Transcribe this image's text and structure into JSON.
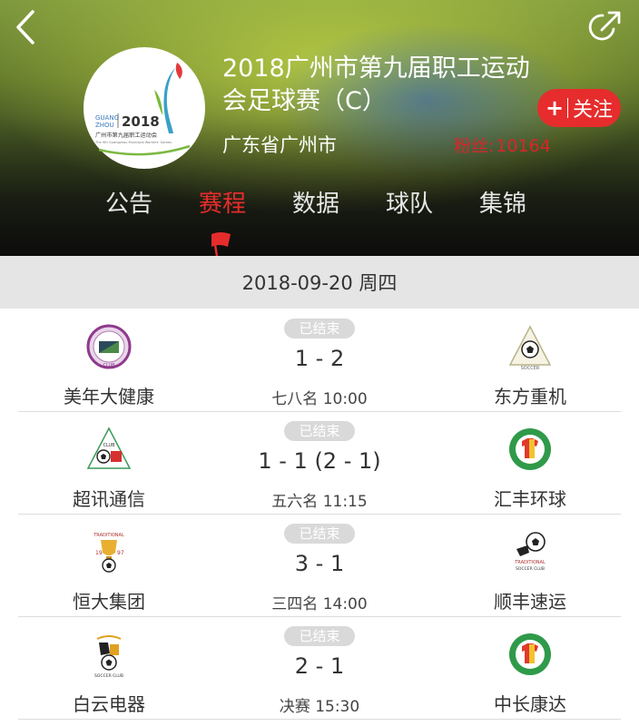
{
  "header": {
    "title": "2018广州市第九届职工运动会足球赛（C）",
    "location": "广东省广州市",
    "follow_plus": "+",
    "follow_label": "关注",
    "fans_label": "粉丝:",
    "fans_count": "10164",
    "logo_text": {
      "city_top": "GUANG",
      "city_bottom": "ZHOU",
      "year": "2018",
      "event_cn": "广州市第九届职工运动会",
      "event_en": "The 9th Guangzhou Municipal Workers' Games"
    }
  },
  "tabs": [
    {
      "label": "公告",
      "active": false
    },
    {
      "label": "赛程",
      "active": true
    },
    {
      "label": "数据",
      "active": false
    },
    {
      "label": "球队",
      "active": false
    },
    {
      "label": "集锦",
      "active": false
    }
  ],
  "date": "2018-09-20 周四",
  "matches": [
    {
      "status": "已结束",
      "score": "1 - 2",
      "round": "七八名 10:00",
      "home": {
        "name": "美年大健康",
        "badge": "purple-circle-badge-icon"
      },
      "away": {
        "name": "东方重机",
        "badge": "triangle-soccer-badge-icon"
      }
    },
    {
      "status": "已结束",
      "score": "1 - 1 (2 - 1)",
      "round": "五六名 11:15",
      "home": {
        "name": "超讯通信",
        "badge": "triangle-soccer-badge-icon"
      },
      "away": {
        "name": "汇丰环球",
        "badge": "green-circle-jersey-badge-icon"
      }
    },
    {
      "status": "已结束",
      "score": "3 - 1",
      "round": "三四名 14:00",
      "home": {
        "name": "恒大集团",
        "badge": "trophy-soccer-badge-icon"
      },
      "away": {
        "name": "顺丰速运",
        "badge": "traditional-soccer-badge-icon"
      }
    },
    {
      "status": "已结束",
      "score": "2 - 1",
      "round": "决赛 15:30",
      "home": {
        "name": "白云电器",
        "badge": "crest-soccer-badge-icon"
      },
      "away": {
        "name": "中长康达",
        "badge": "green-circle-jersey-badge-icon"
      }
    }
  ],
  "colors": {
    "accent": "#e62c2c",
    "status_pill": "#d9d9d9",
    "date_bar": "#e5e5e5"
  }
}
